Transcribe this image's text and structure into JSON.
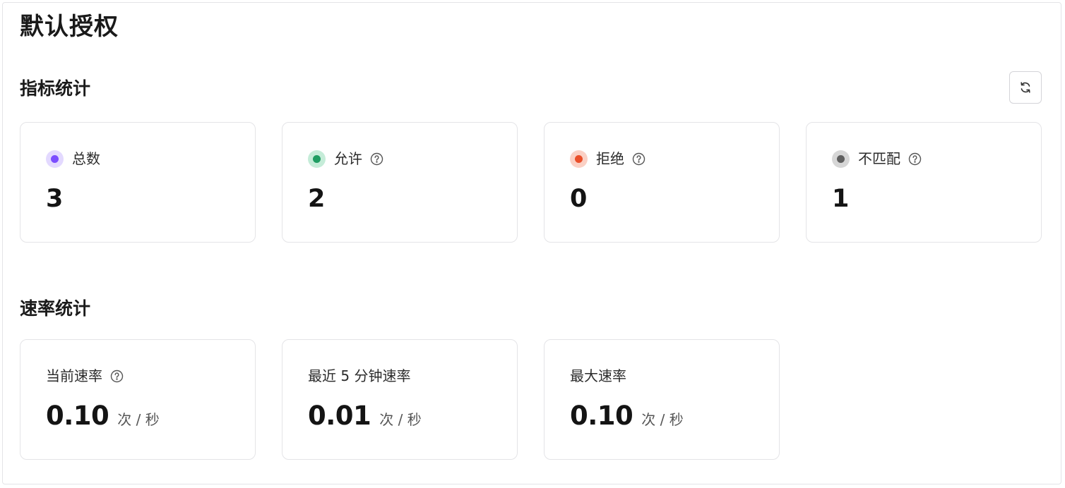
{
  "page": {
    "title": "默认授权"
  },
  "metrics_section": {
    "title": "指标统计",
    "refresh_icon": "refresh-icon",
    "cards": [
      {
        "label": "总数",
        "value": "3",
        "dot_color": "#7c4dff",
        "dot_bg": "#e3d9ff",
        "has_help": false
      },
      {
        "label": "允许",
        "value": "2",
        "dot_color": "#1f9d62",
        "dot_bg": "#c5ecd8",
        "has_help": true
      },
      {
        "label": "拒绝",
        "value": "0",
        "dot_color": "#ea4f2a",
        "dot_bg": "#fbd0c4",
        "has_help": true
      },
      {
        "label": "不匹配",
        "value": "1",
        "dot_color": "#5f5f5f",
        "dot_bg": "#d6d6d6",
        "has_help": true
      }
    ]
  },
  "rate_section": {
    "title": "速率统计",
    "cards": [
      {
        "label": "当前速率",
        "value": "0.10",
        "unit": "次 / 秒",
        "has_help": true
      },
      {
        "label": "最近 5 分钟速率",
        "value": "0.01",
        "unit": "次 / 秒",
        "has_help": false
      },
      {
        "label": "最大速率",
        "value": "0.10",
        "unit": "次 / 秒",
        "has_help": false
      }
    ]
  },
  "colors": {
    "border": "#e4e4e7",
    "text_primary": "#1a1a1a",
    "text_secondary": "#555555"
  }
}
